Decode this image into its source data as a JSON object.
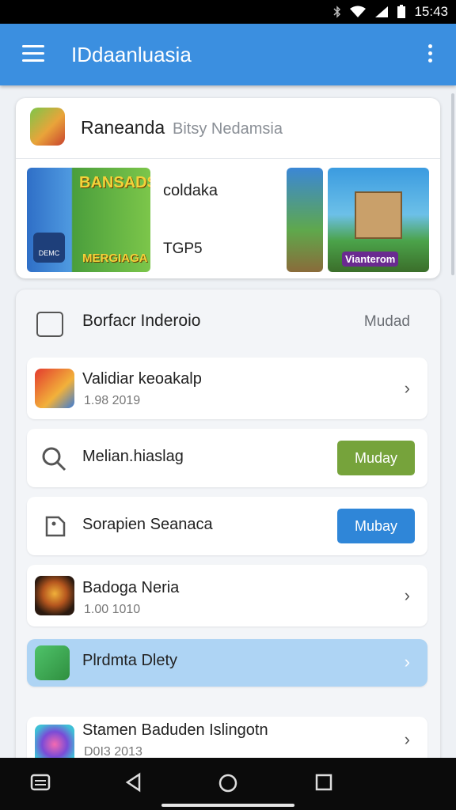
{
  "status_bar": {
    "time": "15:43"
  },
  "app_bar": {
    "title": "IDdaanluasia"
  },
  "featured": {
    "app_name": "Raneanda",
    "app_subtitle": "Bitsy Nedamsia",
    "banner1_title": "BANSADS",
    "banner1_bottom": "MERGIAGA",
    "banner1_small": "DEMC",
    "middle_label": "coldaka",
    "middle_sub": "TGP5",
    "banner3_label": "Vianterom"
  },
  "section": {
    "title": "Borfacr Inderoio",
    "action": "Mudad",
    "rows": [
      {
        "label": "Validiar keoakalp",
        "sub": "1.98 2019",
        "type": "chevron"
      },
      {
        "label": "Melian.hiaslag",
        "button": "Muday",
        "button_color": "#76a33b",
        "type": "button"
      },
      {
        "label": "Sorapien Seanaca",
        "button": "Mubay",
        "button_color": "#2f86d8",
        "type": "button"
      },
      {
        "label": "Badoga Neria",
        "sub": "1.00 1010",
        "type": "chevron"
      },
      {
        "label": "Plrdmta Dlety",
        "type": "chevron",
        "highlighted": true
      },
      {
        "label": "Stamen Baduden Islingotn",
        "sub": "D0I3 2013",
        "type": "chevron"
      }
    ]
  },
  "colors": {
    "accent": "#3b8fe0",
    "green_button": "#76a33b",
    "blue_button": "#2f86d8",
    "highlight_row": "#aed4f4"
  }
}
